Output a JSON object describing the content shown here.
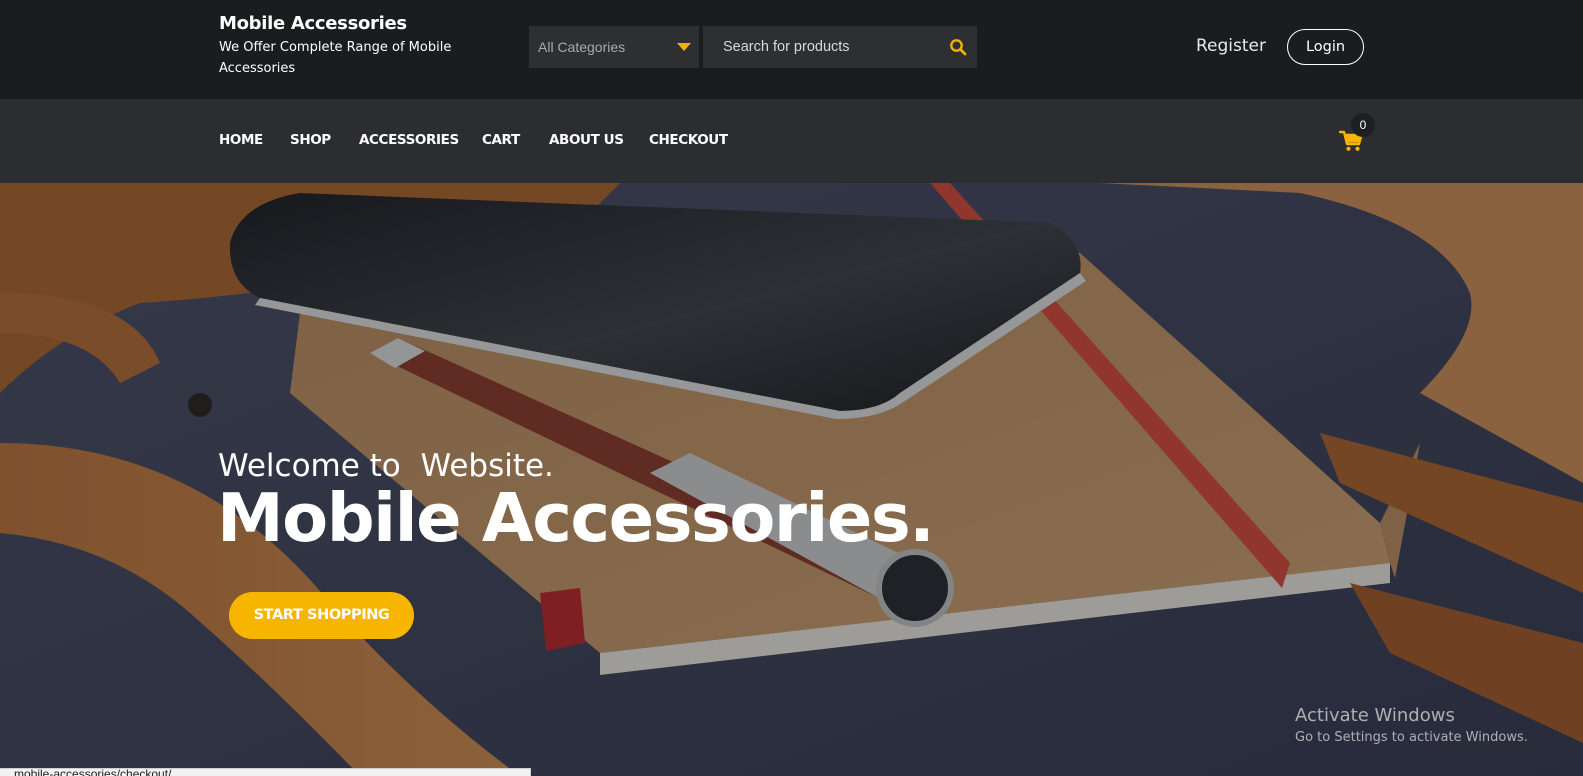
{
  "header": {
    "brand_title": "Mobile Accessories",
    "brand_subtitle": "We Offer Complete Range of Mobile Accessories",
    "category_select": "All Categories",
    "search_placeholder": "Search for products",
    "register_label": "Register",
    "login_label": "Login"
  },
  "nav": {
    "items": [
      "HOME",
      "SHOP",
      "ACCESSORIES",
      "CART",
      "ABOUT US",
      "CHECKOUT"
    ],
    "cart_count": "0"
  },
  "hero": {
    "welcome": "Welcome to  Website.",
    "title": "Mobile Accessories.",
    "cta_label": "START SHOPPING"
  },
  "watermark": {
    "title": "Activate Windows",
    "subtitle": "Go to Settings to activate Windows."
  },
  "status_bar": {
    "url": "...mobile-accessories/checkout/"
  },
  "colors": {
    "accent": "#f8b500",
    "topbar": "#1b1c1e",
    "navbar": "#2c2d30"
  },
  "icons": {
    "search": "search-icon",
    "cart": "cart-icon",
    "caret": "chevron-down-icon"
  }
}
